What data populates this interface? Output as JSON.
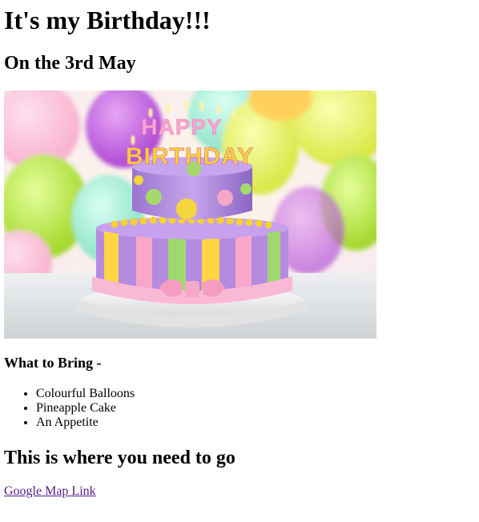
{
  "page": {
    "heading": "It's my Birthday!!!",
    "subheading": "On the 3rd May",
    "image": {
      "name": "birthday-cake-image",
      "topper_line1": "HAPPY",
      "topper_line2": "BIRTHDAY"
    },
    "bring_heading": "What to Bring -",
    "bring_items": [
      "Colourful Balloons",
      "Pineapple Cake",
      "An Appetite"
    ],
    "directions_heading": "This is where you need to go",
    "map_link": {
      "label": "Google Map Link",
      "color": "#551a8b"
    }
  }
}
